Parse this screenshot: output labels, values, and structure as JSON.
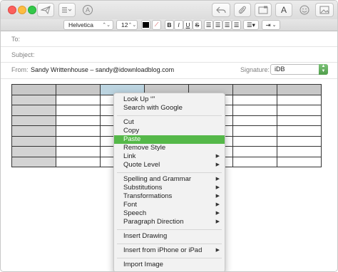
{
  "toolbar": {
    "send_icon": "paper-plane-icon",
    "list_icon": "list-icon",
    "font_icon_label": "A",
    "reply_icon": "reply-arrow-icon",
    "attach_icon": "paperclip-icon",
    "photo_icon": "photo-browser-icon",
    "format_label": "A",
    "emoji_icon": "smiley-icon",
    "photos_icon": "photos-icon"
  },
  "format": {
    "font": "Helvetica",
    "size": "12",
    "bold": "B",
    "italic": "I",
    "underline": "U",
    "strike": "S",
    "indent": "⇥"
  },
  "fields": {
    "to_label": "To:",
    "subject_label": "Subject:",
    "from_label": "From:",
    "from_value": "Sandy Writtenhouse – sandy@idownloadblog.com",
    "signature_label": "Signature:",
    "signature_value": "iDB"
  },
  "colors": {
    "accent": "#55b849",
    "close": "#fc605c",
    "minimize": "#fdbc40",
    "zoom": "#34c84a"
  },
  "menu": {
    "items": [
      {
        "label": "Look Up “”",
        "submenu": false
      },
      {
        "label": "Search with Google",
        "submenu": false
      },
      {
        "label": "Cut",
        "submenu": false
      },
      {
        "label": "Copy",
        "submenu": false
      },
      {
        "label": "Paste",
        "submenu": false
      },
      {
        "label": "Remove Style",
        "submenu": false
      },
      {
        "label": "Link",
        "submenu": true
      },
      {
        "label": "Quote Level",
        "submenu": true
      },
      {
        "label": "Spelling and Grammar",
        "submenu": true
      },
      {
        "label": "Substitutions",
        "submenu": true
      },
      {
        "label": "Transformations",
        "submenu": true
      },
      {
        "label": "Font",
        "submenu": true
      },
      {
        "label": "Speech",
        "submenu": true
      },
      {
        "label": "Paragraph Direction",
        "submenu": true
      },
      {
        "label": "Insert Drawing",
        "submenu": false
      },
      {
        "label": "Insert from iPhone or iPad",
        "submenu": true
      },
      {
        "label": "Import Image",
        "submenu": false
      }
    ],
    "highlighted": "Paste"
  }
}
